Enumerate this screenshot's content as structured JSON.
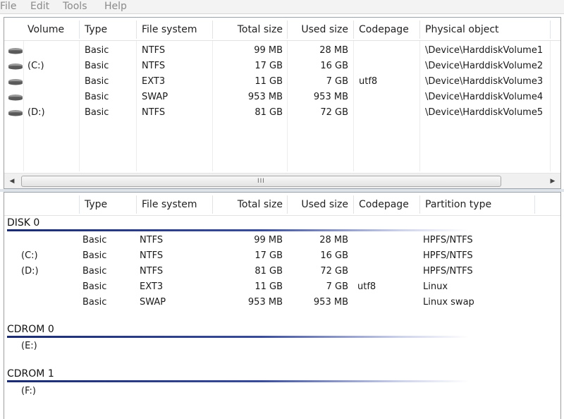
{
  "menu": [
    "File",
    "Edit",
    "Tools",
    "Help"
  ],
  "volumes_table": {
    "columns": [
      "Volume",
      "Type",
      "File system",
      "Total size",
      "Used size",
      "Codepage",
      "Physical object"
    ],
    "rows": [
      {
        "volume": "",
        "type": "Basic",
        "fs": "NTFS",
        "total": "99 MB",
        "used": "28 MB",
        "codepage": "",
        "physical": "\\Device\\HarddiskVolume1"
      },
      {
        "volume": "(C:)",
        "type": "Basic",
        "fs": "NTFS",
        "total": "17 GB",
        "used": "16 GB",
        "codepage": "",
        "physical": "\\Device\\HarddiskVolume2"
      },
      {
        "volume": "",
        "type": "Basic",
        "fs": "EXT3",
        "total": "11 GB",
        "used": "7 GB",
        "codepage": "utf8",
        "physical": "\\Device\\HarddiskVolume3"
      },
      {
        "volume": "",
        "type": "Basic",
        "fs": "SWAP",
        "total": "953 MB",
        "used": "953 MB",
        "codepage": "",
        "physical": "\\Device\\HarddiskVolume4"
      },
      {
        "volume": "(D:)",
        "type": "Basic",
        "fs": "NTFS",
        "total": "81 GB",
        "used": "72 GB",
        "codepage": "",
        "physical": "\\Device\\HarddiskVolume5"
      }
    ],
    "row_icon": "drive-icon",
    "scroll_grip": "III"
  },
  "disks_view": {
    "columns": [
      "",
      "Type",
      "File system",
      "Total size",
      "Used size",
      "Codepage",
      "Partition type"
    ],
    "groups": [
      {
        "title": "DISK 0",
        "rows": [
          {
            "volume": "",
            "type": "Basic",
            "fs": "NTFS",
            "total": "99 MB",
            "used": "28 MB",
            "codepage": "",
            "ptype": "HPFS/NTFS"
          },
          {
            "volume": "(C:)",
            "type": "Basic",
            "fs": "NTFS",
            "total": "17 GB",
            "used": "16 GB",
            "codepage": "",
            "ptype": "HPFS/NTFS"
          },
          {
            "volume": "(D:)",
            "type": "Basic",
            "fs": "NTFS",
            "total": "81 GB",
            "used": "72 GB",
            "codepage": "",
            "ptype": "HPFS/NTFS"
          },
          {
            "volume": "",
            "type": "Basic",
            "fs": "EXT3",
            "total": "11 GB",
            "used": "7 GB",
            "codepage": "utf8",
            "ptype": "Linux"
          },
          {
            "volume": "",
            "type": "Basic",
            "fs": "SWAP",
            "total": "953 MB",
            "used": "953 MB",
            "codepage": "",
            "ptype": "Linux swap"
          }
        ]
      },
      {
        "title": "CDROM 0",
        "rows": [
          {
            "volume": "(E:)"
          }
        ]
      },
      {
        "title": "CDROM 1",
        "rows": [
          {
            "volume": "(F:)"
          }
        ]
      }
    ]
  },
  "colors": {
    "group_line": "#1b2b6e",
    "menu_text": "#8a8a8a"
  }
}
